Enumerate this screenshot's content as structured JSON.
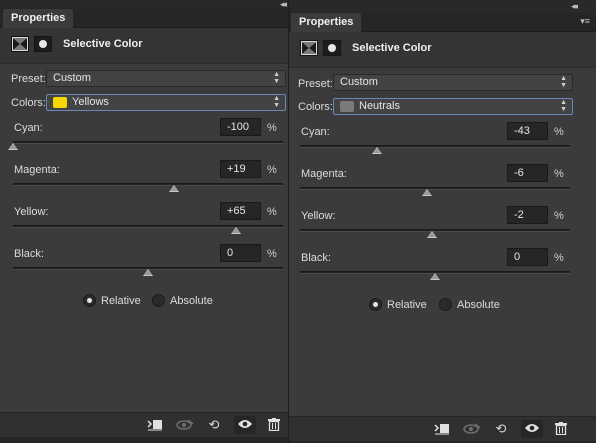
{
  "window": {
    "collapse_glyph": "◂◂"
  },
  "left_panel": {
    "tab_label": "Properties",
    "menu_glyph": "≡",
    "header": {
      "title": "Selective Color",
      "adjustment_icon": "selective-color-icon",
      "mask_icon": "layer-mask-icon"
    },
    "preset": {
      "label": "Preset:",
      "value": "Custom"
    },
    "colors": {
      "label": "Colors:",
      "value": "Yellows",
      "swatch_color": "#f5d800"
    },
    "sliders": [
      {
        "label": "Cyan:",
        "value": "-100",
        "unit": "%",
        "level": -100
      },
      {
        "label": "Magenta:",
        "value": "+19",
        "unit": "%",
        "level": 19
      },
      {
        "label": "Yellow:",
        "value": "+65",
        "unit": "%",
        "level": 65
      },
      {
        "label": "Black:",
        "value": "0",
        "unit": "%",
        "level": 0
      }
    ],
    "method": {
      "options": [
        {
          "label": "Relative",
          "checked": true
        },
        {
          "label": "Absolute",
          "checked": false
        }
      ]
    },
    "footer": {
      "buttons": [
        {
          "icon": "clip-to-layer-icon",
          "enabled": true
        },
        {
          "icon": "view-previous-state-icon",
          "enabled": false
        },
        {
          "icon": "reset-icon",
          "enabled": true
        },
        {
          "icon": "visibility-eye-icon",
          "enabled": true
        },
        {
          "icon": "trash-icon",
          "enabled": true
        }
      ]
    }
  },
  "right_panel": {
    "tab_label": "Properties",
    "menu_glyph": "≡",
    "header": {
      "title": "Selective Color",
      "adjustment_icon": "selective-color-icon",
      "mask_icon": "layer-mask-icon"
    },
    "preset": {
      "label": "Preset:",
      "value": "Custom"
    },
    "colors": {
      "label": "Colors:",
      "value": "Neutrals",
      "swatch_color": "#7a7a7a"
    },
    "sliders": [
      {
        "label": "Cyan:",
        "value": "-43",
        "unit": "%",
        "level": -43
      },
      {
        "label": "Magenta:",
        "value": "-6",
        "unit": "%",
        "level": -6
      },
      {
        "label": "Yellow:",
        "value": "-2",
        "unit": "%",
        "level": -2
      },
      {
        "label": "Black:",
        "value": "0",
        "unit": "%",
        "level": 0
      }
    ],
    "method": {
      "options": [
        {
          "label": "Relative",
          "checked": true
        },
        {
          "label": "Absolute",
          "checked": false
        }
      ]
    },
    "footer": {
      "buttons": [
        {
          "icon": "clip-to-layer-icon",
          "enabled": true
        },
        {
          "icon": "view-previous-state-icon",
          "enabled": false
        },
        {
          "icon": "reset-icon",
          "enabled": true
        },
        {
          "icon": "visibility-eye-icon",
          "enabled": true
        },
        {
          "icon": "trash-icon",
          "enabled": true
        }
      ]
    }
  },
  "colors": {
    "panel_bg": "#3b3b3b",
    "focus_border": "#6a85b8"
  }
}
